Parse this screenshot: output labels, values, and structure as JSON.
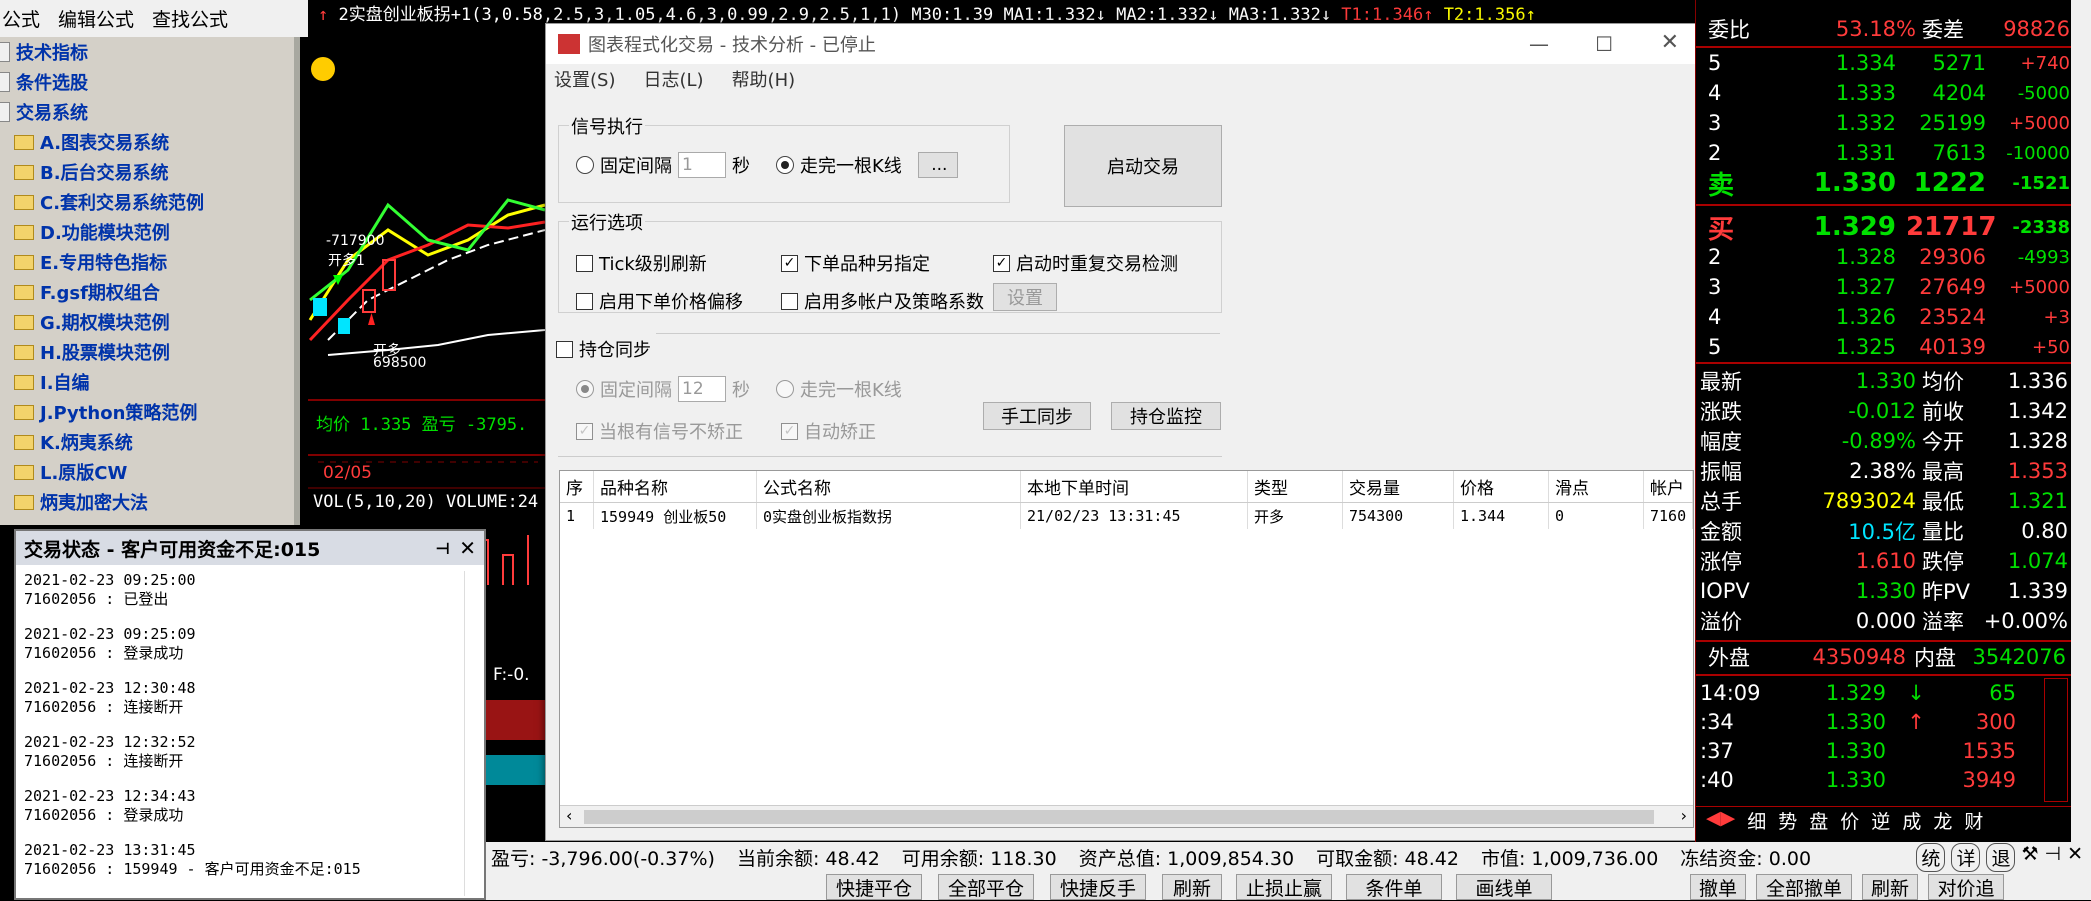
{
  "top_menu": [
    "公式",
    "编辑公式",
    "查找公式"
  ],
  "tree": [
    "技术指标",
    "条件选股",
    "交易系统",
    "A.图表交易系统",
    "B.后台交易系统",
    "C.套利交易系统范例",
    "D.功能模块范例",
    "E.专用特色指标",
    "F.gsf期权组合",
    "G.期权模块范例",
    "H.股票模块范例",
    "I.自编",
    "J.Python策略范例",
    "K.炳夷系统",
    "L.原版CW",
    "炳夷加密大法"
  ],
  "chart_header": {
    "line": "2实盘创业板拐+1(3,0.58,2.5,3,1.05,4.6,3,0.99,2.9,2.5,1,1)",
    "m30": "M30:1.39",
    "ma1": "MA1:1.332",
    "ma2": "MA2:1.332",
    "ma3": "MA3:1.332",
    "t1": "T1:1.346",
    "t2": "T2:1.356"
  },
  "chart_labels": {
    "v1": "-717900",
    "kai": "开多1",
    "v2": "698500",
    "kai2": "开多",
    "avg": "均价 1.335 盈亏 -3795.",
    "date": "02/05",
    "vol": "VOL(5,10,20) VOLUME:24",
    "f": "F:-0."
  },
  "trade_state": {
    "title": "交易状态 - 客户可用资金不足:015",
    "entries": [
      {
        "time": "2021-02-23 09:25:00",
        "msg": "71602056 : 已登出"
      },
      {
        "time": "2021-02-23 09:25:09",
        "msg": "71602056 : 登录成功"
      },
      {
        "time": "2021-02-23 12:30:48",
        "msg": "71602056 : 连接断开"
      },
      {
        "time": "2021-02-23 12:32:52",
        "msg": "71602056 : 连接断开"
      },
      {
        "time": "2021-02-23 12:34:43",
        "msg": "71602056 : 登录成功"
      },
      {
        "time": "2021-02-23 13:31:45",
        "msg": "71602056 : 159949 - 客户可用资金不足:015"
      }
    ]
  },
  "dialog": {
    "title": "图表程式化交易 - 技术分析 - 已停止",
    "menu": [
      "设置(S)",
      "日志(L)",
      "帮助(H)"
    ],
    "signal_group": "信号执行",
    "fixed_interval": "固定间隔",
    "interval_val": "1",
    "sec": "秒",
    "walk_k": "走完一根K线",
    "dots": "...",
    "start_btn": "启动交易",
    "run_group": "运行选项",
    "tick": "Tick级别刷新",
    "order_specified": "下单品种另指定",
    "repeat_check": "启动时重复交易检测",
    "price_offset": "启用下单价格偏移",
    "multi_acct": "启用多帐户及策略系数",
    "settings_btn": "设置",
    "pos_sync": "持仓同步",
    "pos_interval_val": "12",
    "pos_sec": "秒",
    "pos_walk": "走完一根K线",
    "no_correct": "当根有信号不矫正",
    "auto_correct": "自动矫正",
    "manual_sync": "手工同步",
    "pos_monitor": "持仓监控",
    "columns": [
      "序",
      "品种名称",
      "公式名称",
      "本地下单时间",
      "类型",
      "交易量",
      "价格",
      "滑点",
      "帐户"
    ],
    "rows": [
      [
        "1",
        "159949 创业板50",
        "0实盘创业板指数拐",
        "21/02/23 13:31:45",
        "开多",
        "754300",
        "1.344",
        "0",
        "7160"
      ]
    ]
  },
  "quote": {
    "weibi_l": "委比",
    "weibi": "53.18%",
    "weicha_l": "委差",
    "weicha": "98826",
    "sells": [
      [
        "5",
        "1.334",
        "5271",
        "+740"
      ],
      [
        "4",
        "1.333",
        "4204",
        "-5000"
      ],
      [
        "3",
        "1.332",
        "25199",
        "+5000"
      ],
      [
        "2",
        "1.331",
        "7613",
        "-10000"
      ],
      [
        "卖",
        "1.330",
        "1222",
        "-1521"
      ]
    ],
    "buys": [
      [
        "买",
        "1.329",
        "21717",
        "-2338"
      ],
      [
        "2",
        "1.328",
        "29306",
        "-4993"
      ],
      [
        "3",
        "1.327",
        "27649",
        "+5000"
      ],
      [
        "4",
        "1.326",
        "23524",
        "+3"
      ],
      [
        "5",
        "1.325",
        "40139",
        "+50"
      ]
    ],
    "stats": [
      [
        "最新",
        "1.330",
        "均价",
        "1.336"
      ],
      [
        "涨跌",
        "-0.012",
        "前收",
        "1.342"
      ],
      [
        "幅度",
        "-0.89%",
        "今开",
        "1.328"
      ],
      [
        "振幅",
        "2.38%",
        "最高",
        "1.353"
      ],
      [
        "总手",
        "7893024",
        "最低",
        "1.321"
      ],
      [
        "金额",
        "10.5亿",
        "量比",
        "0.80"
      ],
      [
        "涨停",
        "1.610",
        "跌停",
        "1.074"
      ],
      [
        "IOPV",
        "1.330",
        "昨PV",
        "1.339"
      ],
      [
        "溢价",
        "0.000",
        "溢率",
        "+0.00%"
      ]
    ],
    "waipan_l": "外盘",
    "waipan": "4350948",
    "neipan_l": "内盘",
    "neipan": "3542076",
    "ticks": [
      [
        "14:09",
        "1.329",
        "↓",
        "65"
      ],
      [
        ":34",
        "1.330",
        "↑",
        "300"
      ],
      [
        ":37",
        "1.330",
        "",
        "1535"
      ],
      [
        ":40",
        "1.330",
        "",
        "3949"
      ]
    ],
    "tabs": [
      "细",
      "势",
      "盘",
      "价",
      "逆",
      "成",
      "龙",
      "财"
    ]
  },
  "status": {
    "pnl": "盈亏: -3,796.00(-0.37%)",
    "cur_bal": "当前余额: 48.42",
    "avail": "可用余额: 118.30",
    "total": "资产总值: 1,009,854.30",
    "withdraw": "可取金额: 48.42",
    "mkt": "市值: 1,009,736.00",
    "frozen": "冻结资金: 0.00",
    "icons": [
      "统",
      "详",
      "退"
    ]
  },
  "bottom_buttons": [
    "快捷平仓",
    "全部平仓",
    "快捷反手",
    "刷新",
    "止损止赢",
    "条件单",
    "画线单",
    "撤单",
    "全部撤单",
    "刷新",
    "对价追"
  ]
}
